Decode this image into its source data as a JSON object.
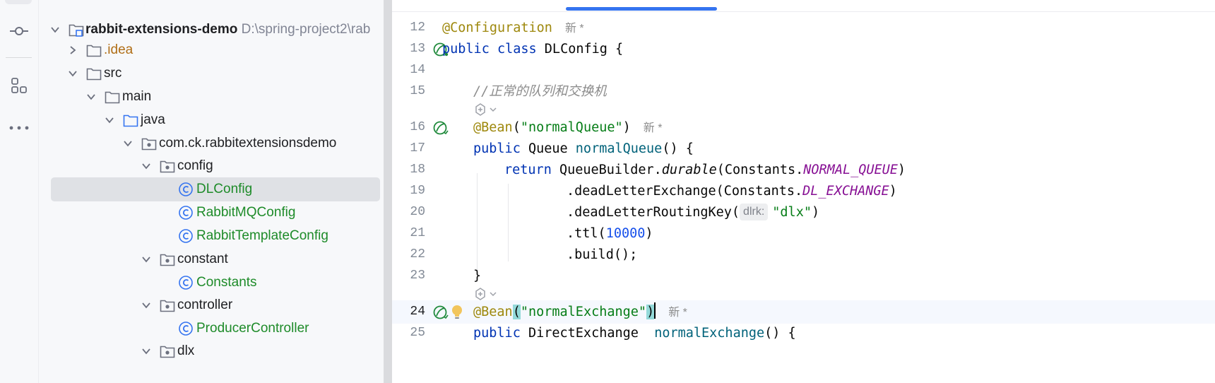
{
  "tree": {
    "rows": [
      {
        "label": "rabbit-extensions-demo",
        "path": "D:\\spring-project2\\rab"
      },
      {
        "label": ".idea"
      },
      {
        "label": "src"
      },
      {
        "label": "main"
      },
      {
        "label": "java"
      },
      {
        "label": "com.ck.rabbitextensionsdemo"
      },
      {
        "label": "config"
      },
      {
        "label": "DLConfig"
      },
      {
        "label": "RabbitMQConfig"
      },
      {
        "label": "RabbitTemplateConfig"
      },
      {
        "label": "constant"
      },
      {
        "label": "Constants"
      },
      {
        "label": "controller"
      },
      {
        "label": "ProducerController"
      },
      {
        "label": "dlx"
      }
    ],
    "selected": "DLConfig"
  },
  "toolwindow_strip": {
    "icons": [
      "commit-icon",
      "structure-icon",
      "more-icon"
    ]
  },
  "editor": {
    "line_numbers": [
      "12",
      "13",
      "14",
      "15",
      "16",
      "17",
      "18",
      "19",
      "20",
      "21",
      "22",
      "23",
      "24",
      "25"
    ],
    "new_marker": "新 *",
    "code": {
      "l12_ann": "@Configuration",
      "l13_kw": "public class",
      "l13_rest": " DLConfig {",
      "l15_comment": "//正常的队列和交换机",
      "l16_ann": "@Bean",
      "l16_open": "(",
      "l16_str": "\"normalQueue\"",
      "l16_close": ")",
      "l17_kw": "public",
      "l17_type": " Queue ",
      "l17_fn": "normalQueue",
      "l17_rest": "() {",
      "l18_kw": "return",
      "l18_a": " QueueBuilder.",
      "l18_method": "durable",
      "l18_b": "(Constants.",
      "l18_const": "NORMAL_QUEUE",
      "l18_c": ")",
      "l19_a": ".deadLetterExchange(Constants.",
      "l19_const": "DL_EXCHANGE",
      "l19_b": ")",
      "l20_a": ".deadLetterRoutingKey(",
      "l20_hint": "dlrk:",
      "l20_str": "\"dlx\"",
      "l20_b": ")",
      "l21_a": ".ttl(",
      "l21_num": "10000",
      "l21_b": ")",
      "l22": ".build();",
      "l23": "}",
      "l24_ann": "@Bean",
      "l24_open": "(",
      "l24_str": "\"normalExchange\"",
      "l24_close": ")",
      "l25_kw": "public",
      "l25_type": " DirectExchange  ",
      "l25_fn": "normalExchange",
      "l25_rest": "() {"
    },
    "gutter_icons": [
      "spring-bean-icon",
      "spring-bean-icon",
      "spring-bean-icon"
    ],
    "intention_icon": "lightbulb-icon",
    "inference_icon": "ai-inference-icon"
  }
}
